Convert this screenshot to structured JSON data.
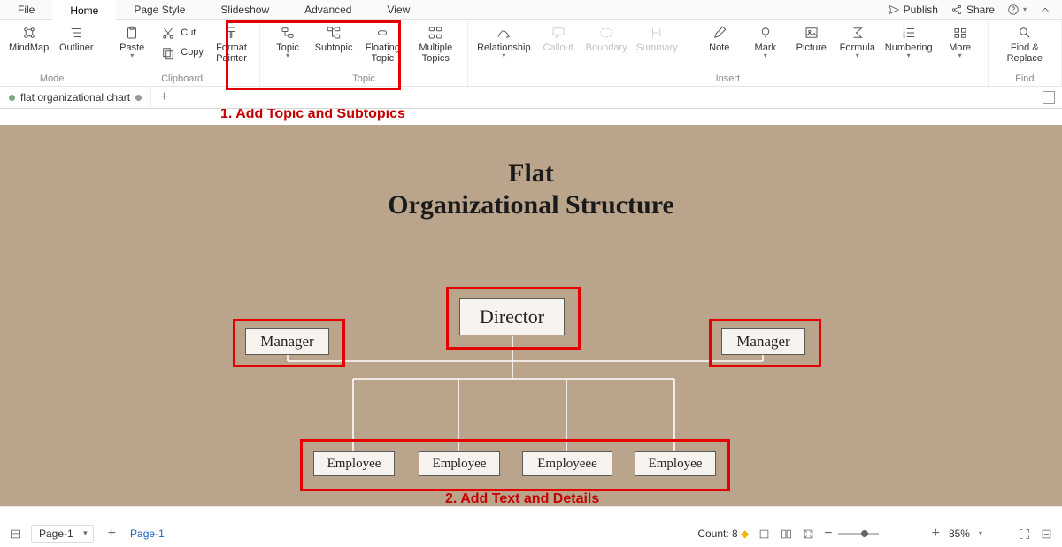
{
  "tabs": {
    "items": [
      "File",
      "Home",
      "Page Style",
      "Slideshow",
      "Advanced",
      "View"
    ],
    "active": 1
  },
  "topright": {
    "publish": "Publish",
    "share": "Share"
  },
  "ribbon": {
    "mode": {
      "label": "Mode",
      "mindmap": "MindMap",
      "outliner": "Outliner"
    },
    "clipboard": {
      "label": "Clipboard",
      "paste": "Paste",
      "cut": "Cut",
      "copy": "Copy",
      "format": "Format Painter"
    },
    "topic": {
      "label": "Topic",
      "topic": "Topic",
      "subtopic": "Subtopic",
      "floating": "Floating Topic",
      "multiple": "Multiple Topics"
    },
    "insert": {
      "label": "Insert",
      "relationship": "Relationship",
      "callout": "Callout",
      "boundary": "Boundary",
      "summary": "Summary",
      "note": "Note",
      "mark": "Mark",
      "picture": "Picture",
      "formula": "Formula",
      "numbering": "Numbering",
      "more": "More"
    },
    "find": {
      "label": "Find",
      "findreplace": "Find & Replace"
    }
  },
  "doc": {
    "name": "flat organizational chart"
  },
  "annotations": {
    "a1": "1. Add Topic and Subtopics",
    "a2": "2. Add Text and Details"
  },
  "chart_data": {
    "type": "org-chart",
    "title_line1": "Flat",
    "title_line2": "Organizational Structure",
    "nodes": {
      "director": "Director",
      "manager_l": "Manager",
      "manager_r": "Manager",
      "emp1": "Employee",
      "emp2": "Employee",
      "emp3": "Employeee",
      "emp4": "Employee"
    }
  },
  "status": {
    "page_select": "Page-1",
    "page_label": "Page-1",
    "count_label": "Count: 8",
    "zoom": "85%"
  }
}
